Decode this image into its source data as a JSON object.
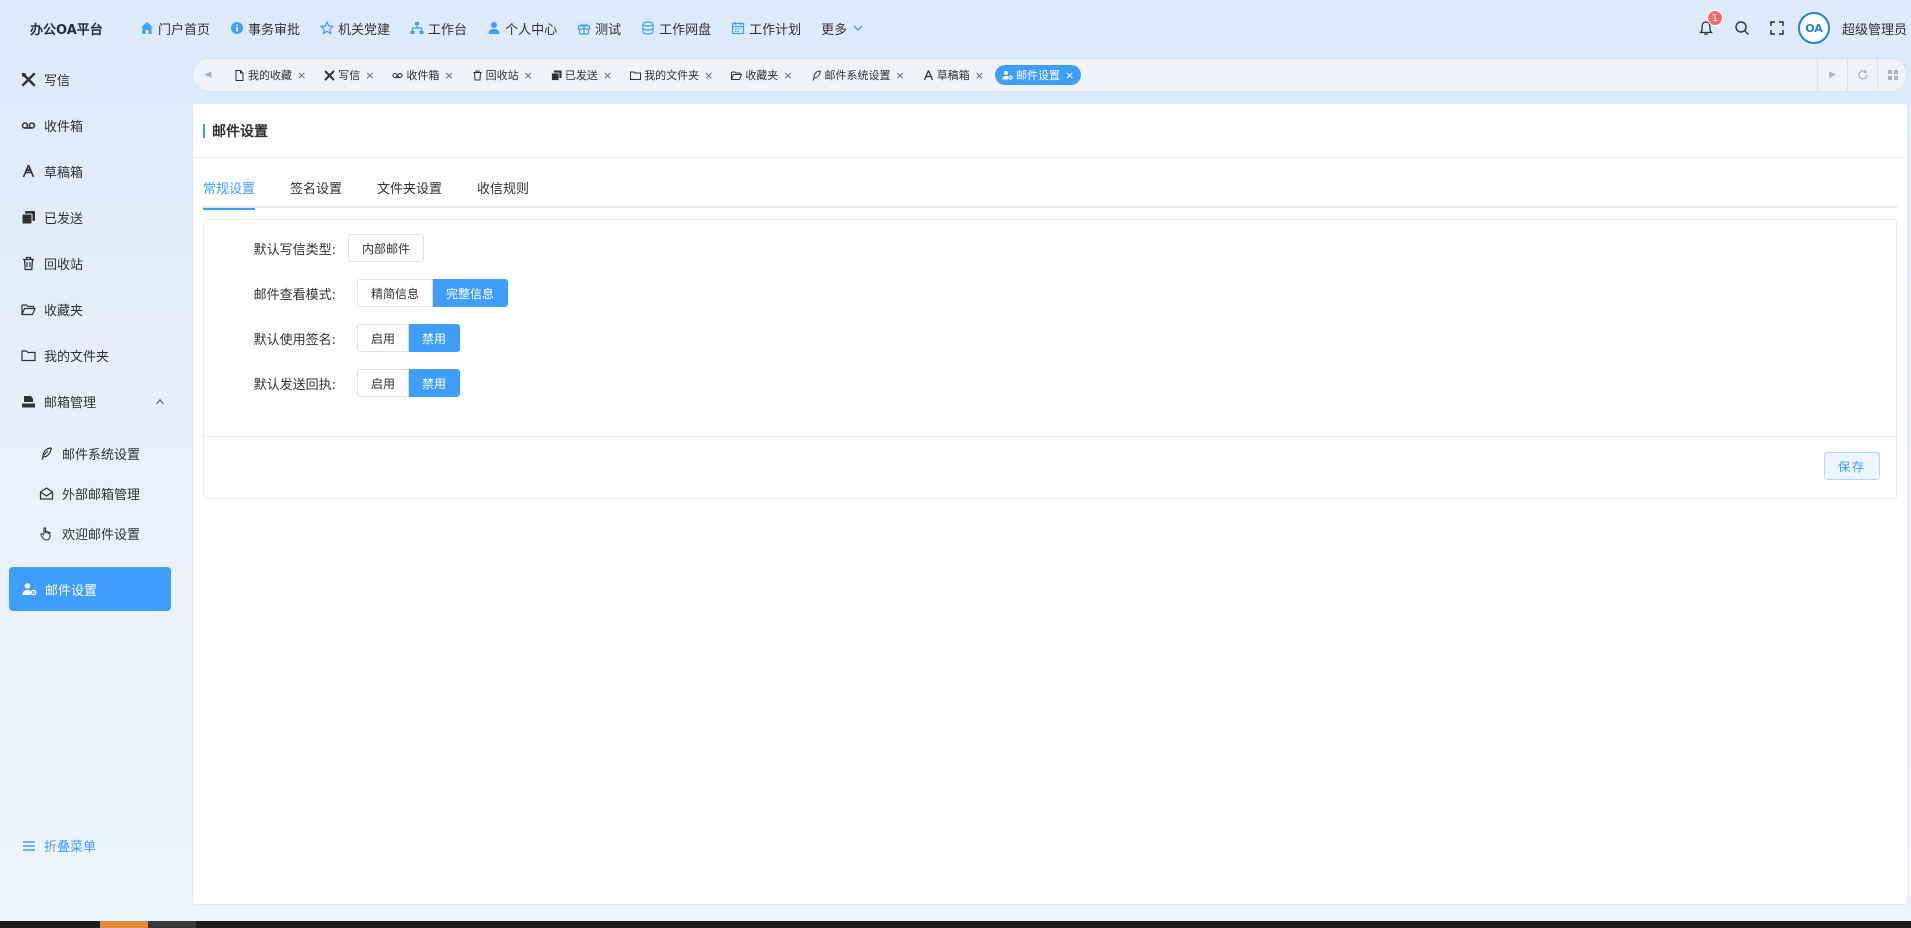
{
  "header": {
    "brand": "办公OA平台",
    "nav": [
      {
        "label": "门户首页",
        "icon": "home-icon"
      },
      {
        "label": "事务审批",
        "icon": "info-icon"
      },
      {
        "label": "机关党建",
        "icon": "star-icon"
      },
      {
        "label": "工作台",
        "icon": "sitemap-icon"
      },
      {
        "label": "个人中心",
        "icon": "user-icon"
      },
      {
        "label": "测试",
        "icon": "gift-icon"
      },
      {
        "label": "工作网盘",
        "icon": "database-icon"
      },
      {
        "label": "工作计划",
        "icon": "calendar-icon"
      }
    ],
    "more_label": "更多",
    "notification_count": "1",
    "avatar_text": "OA",
    "username": "超级管理员"
  },
  "sidebar": {
    "items": [
      {
        "label": "写信",
        "icon": "compose-icon"
      },
      {
        "label": "收件箱",
        "icon": "voicemail-icon"
      },
      {
        "label": "草稿箱",
        "icon": "pen-tool-icon"
      },
      {
        "label": "已发送",
        "icon": "copy-icon"
      },
      {
        "label": "回收站",
        "icon": "trash-icon"
      },
      {
        "label": "收藏夹",
        "icon": "folder-open-icon"
      },
      {
        "label": "我的文件夹",
        "icon": "folder-icon"
      },
      {
        "label": "邮箱管理",
        "icon": "inbox-stack-icon"
      }
    ],
    "sub_items": [
      {
        "label": "邮件系统设置",
        "icon": "feather-icon"
      },
      {
        "label": "外部邮箱管理",
        "icon": "mail-open-icon"
      },
      {
        "label": "欢迎邮件设置",
        "icon": "hand-pointer-icon"
      }
    ],
    "active_item": {
      "label": "邮件设置",
      "icon": "user-cog-icon"
    },
    "collapse_label": "折叠菜单"
  },
  "tabs": [
    {
      "label": "我的收藏",
      "icon": "file-icon"
    },
    {
      "label": "写信",
      "icon": "compose-icon"
    },
    {
      "label": "收件箱",
      "icon": "voicemail-icon"
    },
    {
      "label": "回收站",
      "icon": "trash-icon"
    },
    {
      "label": "已发送",
      "icon": "copy-icon"
    },
    {
      "label": "我的文件夹",
      "icon": "folder-icon"
    },
    {
      "label": "收藏夹",
      "icon": "folder-open-icon"
    },
    {
      "label": "邮件系统设置",
      "icon": "feather-icon"
    },
    {
      "label": "草稿箱",
      "icon": "pen-tool-icon"
    },
    {
      "label": "邮件设置",
      "icon": "user-cog-icon",
      "active": true
    }
  ],
  "tab_close": "×",
  "page": {
    "title": "邮件设置",
    "settings_tabs": [
      "常规设置",
      "签名设置",
      "文件夹设置",
      "收信规则"
    ],
    "active_settings_tab": "常规设置",
    "form": {
      "default_type": {
        "label": "默认写信类型:",
        "value": "内部邮件"
      },
      "view_mode": {
        "label": "邮件查看模式:",
        "options": [
          "精简信息",
          "完整信息"
        ],
        "selected": "完整信息"
      },
      "use_signature": {
        "label": "默认使用签名:",
        "options": [
          "启用",
          "禁用"
        ],
        "selected": "禁用"
      },
      "send_receipt": {
        "label": "默认发送回执:",
        "options": [
          "启用",
          "禁用"
        ],
        "selected": "禁用"
      }
    },
    "save_label": "保存"
  },
  "colors": {
    "accent": "#409eff",
    "badge": "#f56c6c",
    "text": "#303133"
  }
}
